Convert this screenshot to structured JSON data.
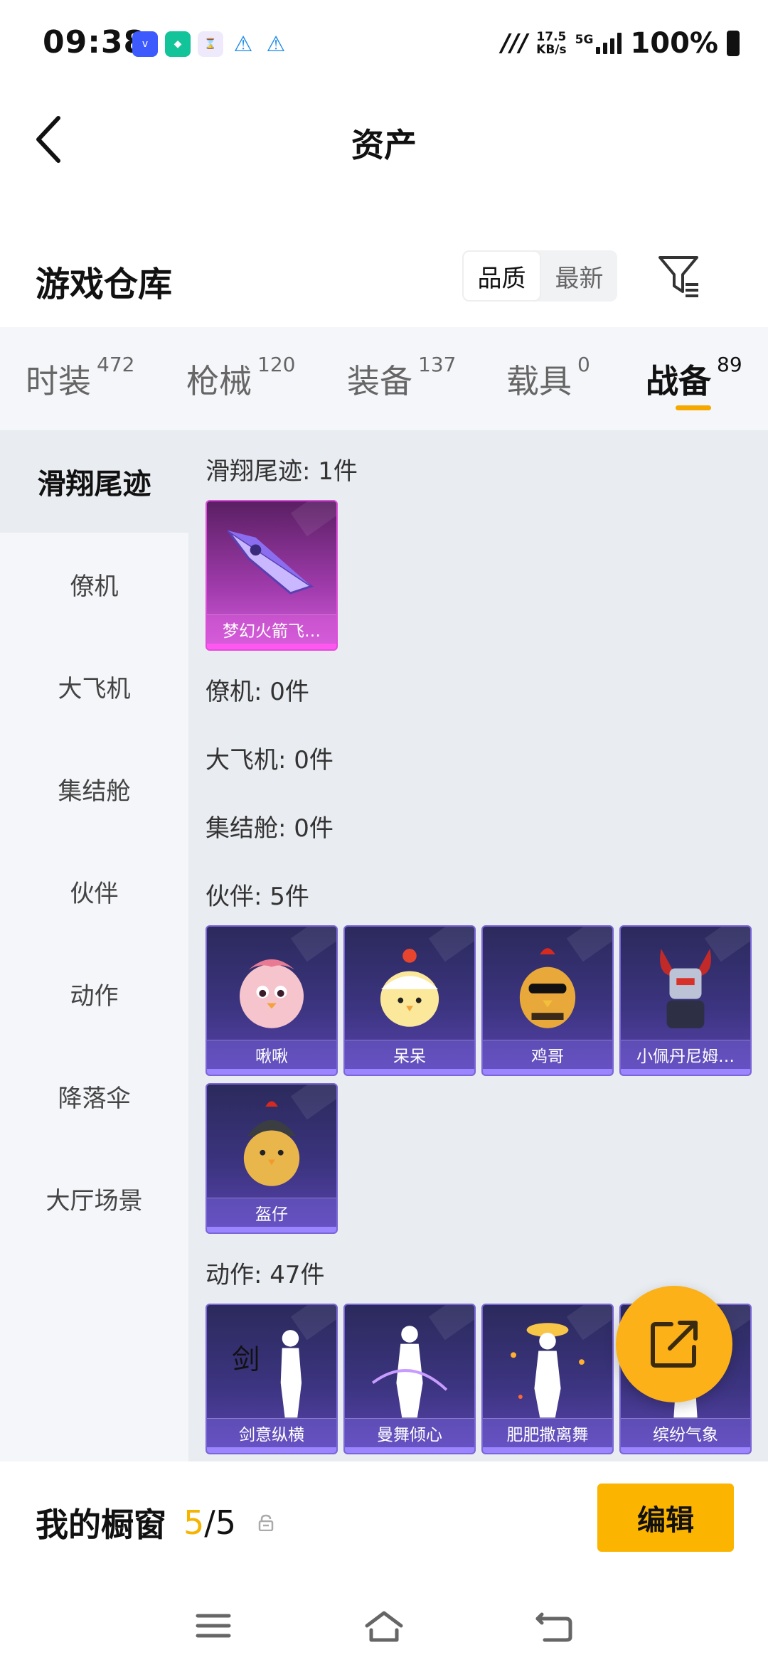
{
  "status_bar": {
    "time": "09:38",
    "speed_value": "17.5",
    "speed_unit": "KB/s",
    "network": "5G",
    "battery": "100%"
  },
  "header": {
    "title": "资产"
  },
  "warehouse": {
    "title": "游戏仓库",
    "sort_options": [
      "品质",
      "最新"
    ],
    "sort_selected": "品质"
  },
  "tabs": [
    {
      "label": "时装",
      "count": "472"
    },
    {
      "label": "枪械",
      "count": "120"
    },
    {
      "label": "装备",
      "count": "137"
    },
    {
      "label": "载具",
      "count": "0"
    },
    {
      "label": "战备",
      "count": "89"
    }
  ],
  "active_tab": "战备",
  "sidebar": {
    "items": [
      "滑翔尾迹",
      "僚机",
      "大飞机",
      "集结舱",
      "伙伴",
      "动作",
      "降落伞",
      "大厅场景"
    ]
  },
  "sections": {
    "glide": {
      "title": "滑翔尾迹: 1件",
      "items": [
        "梦幻火箭飞…"
      ]
    },
    "wingman": {
      "title": "僚机: 0件"
    },
    "big_plane": {
      "title": "大飞机: 0件"
    },
    "assembly": {
      "title": "集结舱: 0件"
    },
    "partner": {
      "title": "伙伴: 5件",
      "items": [
        "啾啾",
        "呆呆",
        "鸡哥",
        "小佩丹尼姆…",
        "盔仔"
      ]
    },
    "action": {
      "title": "动作: 47件",
      "items": [
        "剑意纵横",
        "曼舞倾心",
        "肥肥撒离舞",
        "缤纷气象"
      ]
    }
  },
  "showcase": {
    "title": "我的橱窗",
    "current": "5",
    "separator": "/",
    "total": "5"
  },
  "edit_button": "编辑",
  "colors": {
    "accent": "#fbb400",
    "card_purple": "#3c3480",
    "card_pink": "#a23cae"
  }
}
